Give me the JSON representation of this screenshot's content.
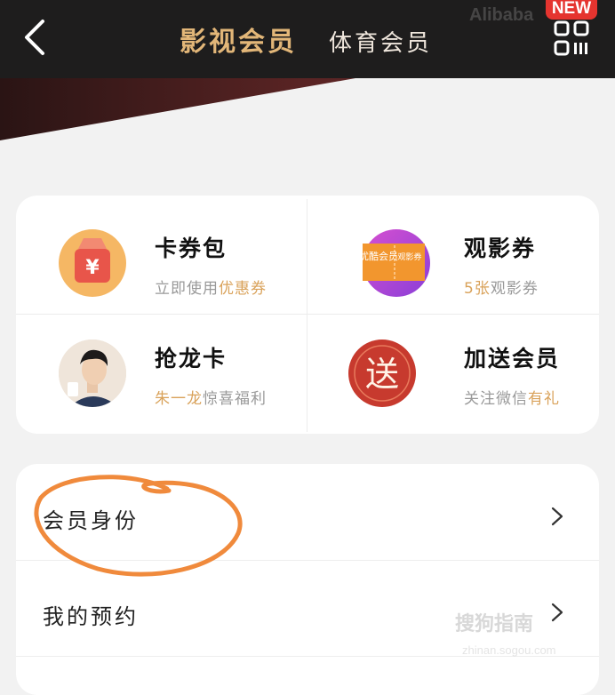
{
  "header": {
    "tab_active": "影视会员",
    "tab_inactive": "体育会员",
    "watermark": "Alibaba",
    "new_badge": "NEW"
  },
  "benefits": [
    {
      "title": "卡券包",
      "sub_plain": "立即使用",
      "sub_highlight": "优惠券",
      "icon": "coupon-wallet-icon"
    },
    {
      "title": "观影券",
      "sub_highlight": "5张",
      "sub_plain": "观影券",
      "icon": "movie-ticket-icon",
      "ticket_left": "优酷会员",
      "ticket_right": "观影券"
    },
    {
      "title": "抢龙卡",
      "sub_highlight": "朱一龙",
      "sub_plain": "惊喜福利",
      "icon": "celebrity-avatar-icon"
    },
    {
      "title": "加送会员",
      "sub_plain": "关注微信",
      "sub_highlight": "有礼",
      "icon": "gift-seal-icon",
      "seal_char": "送"
    }
  ],
  "menu": [
    {
      "label": "会员身份"
    },
    {
      "label": "我的预约"
    }
  ],
  "watermark": {
    "text": "搜狗指南",
    "url": "zhinan.sogou.com"
  },
  "colors": {
    "accent_gold": "#e2b678",
    "highlight": "#d9a25a",
    "annotation": "#f08a3c",
    "badge_red": "#e5342f"
  }
}
